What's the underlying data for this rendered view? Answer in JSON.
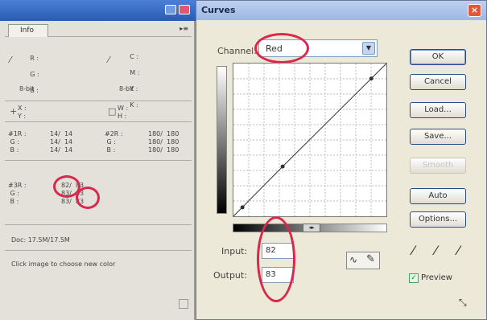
{
  "info_panel": {
    "tab": "Info",
    "color_labels_rgb": {
      "r": "R :",
      "g": "G :",
      "b": "B :"
    },
    "cmyk_labels": {
      "c": "C :",
      "m": "M :",
      "y": "Y :",
      "k": "K :"
    },
    "bit_depth_left": "8-bit",
    "bit_depth_right": "8-bit",
    "xy_labels": "X :\nY :",
    "wh_labels": "W :\nH :",
    "sample1_labels": "#1R :\n G :\n B :",
    "sample1_values": "14/  14\n14/  14\n14/  14",
    "sample2_labels": "#2R :\n G :\n B :",
    "sample2_values": "180/  180\n180/  180\n180/  180",
    "sample3_labels": "#3R :\n G :\n B :",
    "sample3_values": "82/  83\n83/  83\n83/  83",
    "doc_size": "Doc: 17.5M/17.5M",
    "status": "Click image to choose new color"
  },
  "dialog": {
    "title": "Curves",
    "channel_label": "Channel:",
    "channel_value": "Red",
    "input_label": "Input:",
    "input_value": "82",
    "output_label": "Output:",
    "output_value": "83",
    "buttons": {
      "ok": "OK",
      "cancel": "Cancel",
      "load": "Load...",
      "save": "Save...",
      "smooth": "Smooth",
      "auto": "Auto",
      "options": "Options..."
    },
    "preview_label": "Preview",
    "preview_checked": true
  },
  "curve": {
    "points": [
      [
        0,
        0
      ],
      [
        82,
        83
      ],
      [
        255,
        255
      ]
    ],
    "range": [
      0,
      255
    ]
  },
  "colors": {
    "highlight": "#d9284c",
    "title_bar": "#9eb8e4",
    "palette_bar": "#2a5bb0"
  }
}
